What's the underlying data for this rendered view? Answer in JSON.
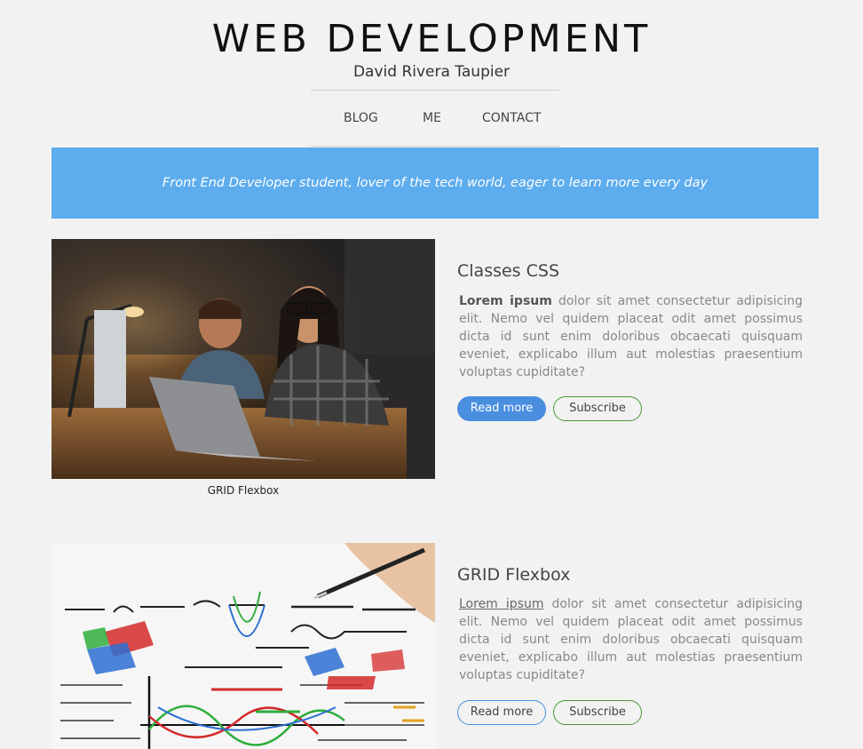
{
  "header": {
    "title": "WEB DEVELOPMENT",
    "author": "David Rivera Taupier"
  },
  "nav": {
    "items": [
      {
        "label": "BLOG"
      },
      {
        "label": "ME"
      },
      {
        "label": "CONTACT"
      }
    ]
  },
  "banner": {
    "text": "Front End Developer student, lover of the tech world, eager to learn more every day"
  },
  "posts": [
    {
      "caption": "GRID Flexbox",
      "title": "Classes CSS",
      "lead": "Lorem ipsum",
      "body": " dolor sit amet consectetur adipisicing elit. Nemo vel quidem placeat odit amet possimus dicta id sunt enim doloribus obcaecati quisquam eveniet, explicabo illum aut molestias praesentium voluptas cupiditate?",
      "read_more": "Read more",
      "subscribe": "Subscribe"
    },
    {
      "title": "GRID Flexbox",
      "lead": "Lorem ipsum",
      "body": " dolor sit amet consectetur adipisicing elit. Nemo vel quidem placeat odit amet possimus dicta id sunt enim doloribus obcaecati quisquam eveniet, explicabo illum aut molestias praesentium voluptas cupiditate?",
      "read_more": "Read more",
      "subscribe": "Subscribe"
    }
  ],
  "colors": {
    "banner": "#5daced",
    "primary_button": "#4a8ee0",
    "subscribe_border": "#4a9a3a",
    "background": "#f2f2f2"
  }
}
